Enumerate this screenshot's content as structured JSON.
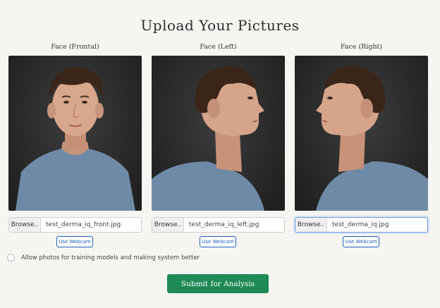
{
  "page": {
    "title": "Upload Your Pictures"
  },
  "uploads": [
    {
      "label": "Face (Frontal)",
      "browse_label": "Browse..",
      "file_name": "test_derma_iq_front.jpg",
      "webcam_label": "Use Webcam",
      "image": "frontal-face-photo"
    },
    {
      "label": "Face (Left)",
      "browse_label": "Browse..",
      "file_name": "test_derma_iq_left.jpg",
      "webcam_label": "Use Webcam",
      "image": "left-profile-photo"
    },
    {
      "label": "Face (Right)",
      "browse_label": "Browse..",
      "file_name": "test_derma_iq.jpg",
      "webcam_label": "Use Webcam",
      "image": "right-profile-photo"
    }
  ],
  "consent": {
    "label": "Allow photos for training models and making system better",
    "checked": false
  },
  "submit": {
    "label": "Submit for Analysis"
  },
  "colors": {
    "accent": "#1e8a55",
    "link": "#1d5fbf",
    "background": "#f7f5f1"
  }
}
